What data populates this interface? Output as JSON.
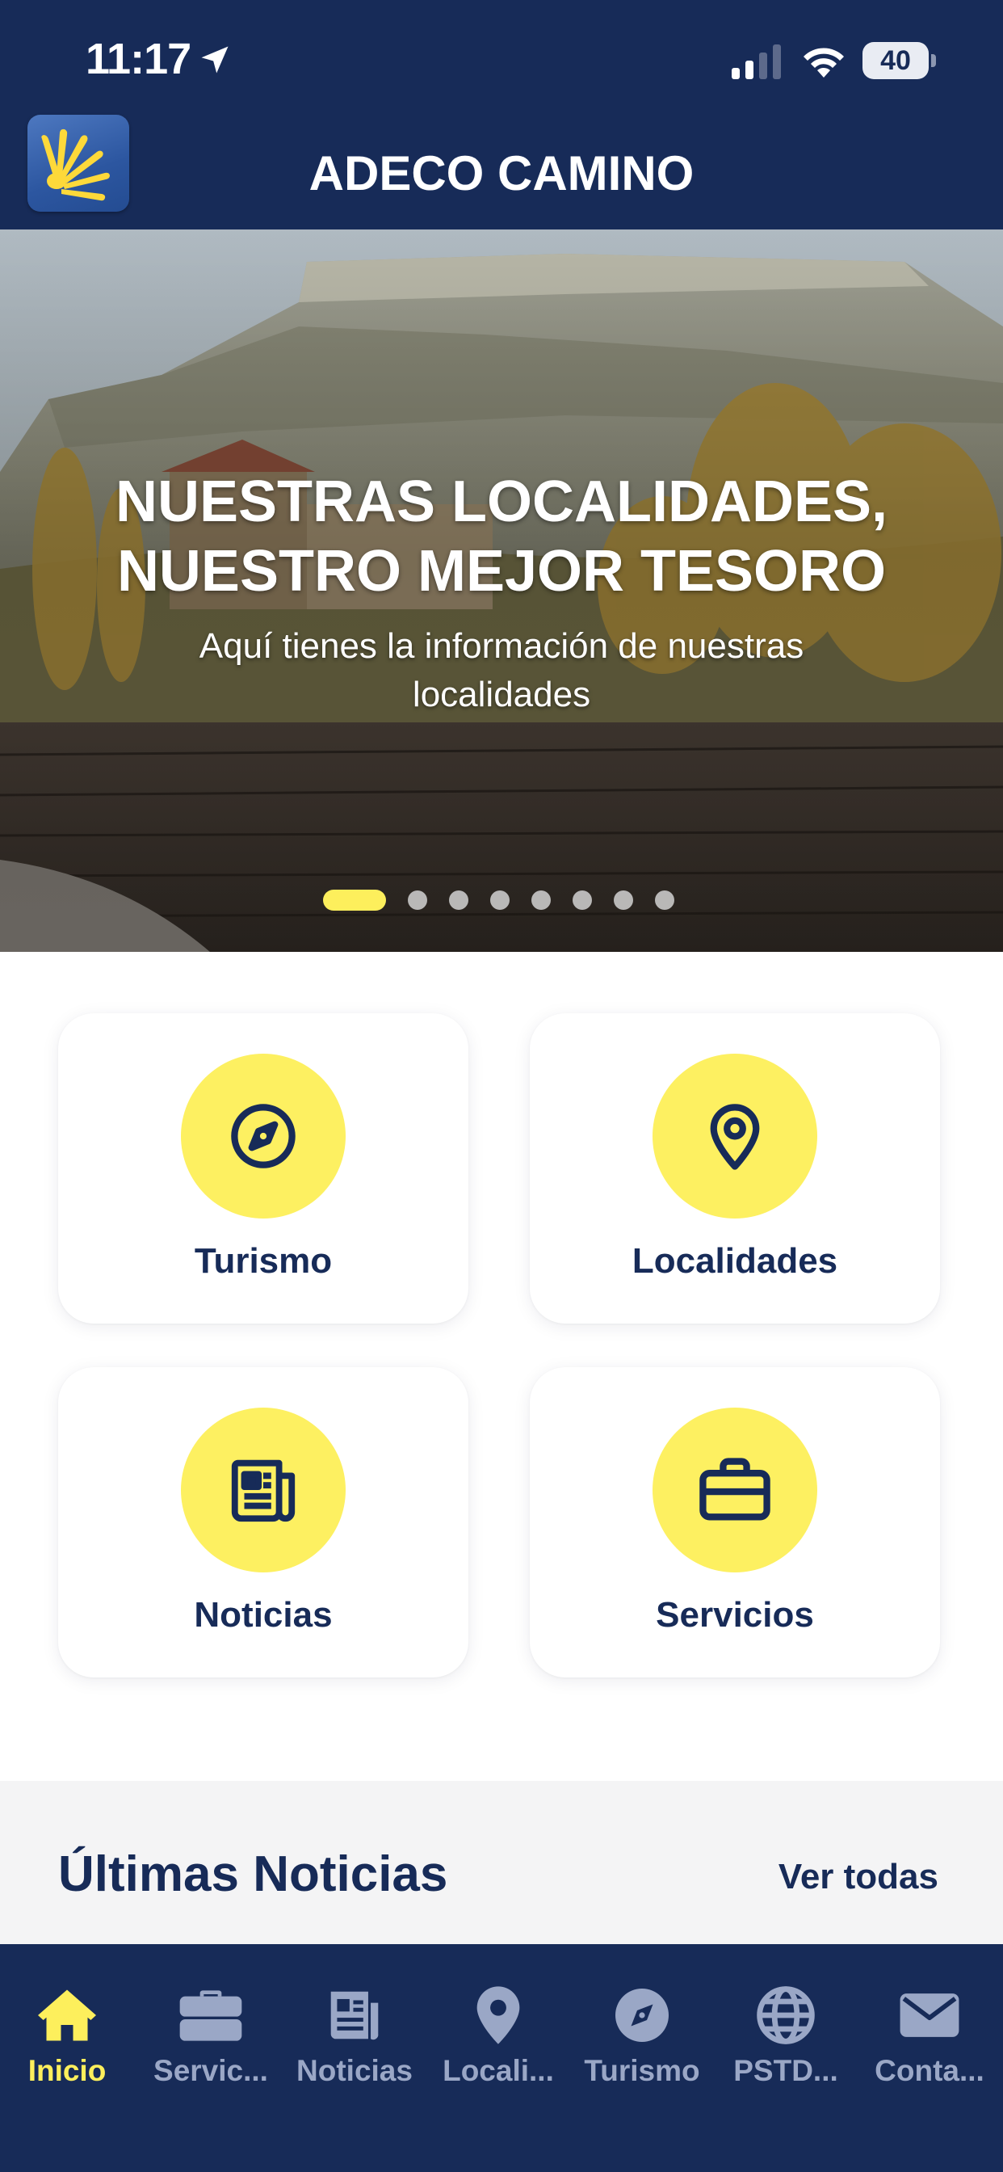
{
  "status_bar": {
    "time": "11:17",
    "battery": "40",
    "icons": [
      "location-arrow-icon",
      "cellular-signal-icon",
      "wifi-icon",
      "battery-icon"
    ]
  },
  "header": {
    "title": "ADECO CAMINO",
    "logo_icon": "scallop-shell-icon"
  },
  "hero": {
    "heading": "NUESTRAS LOCALIDADES, NUESTRO MEJOR TESORO",
    "subtitle": "Aquí tienes la información de nuestras localidades",
    "slide_count": 8,
    "active_slide": 1
  },
  "grid": {
    "items": [
      {
        "label": "Turismo",
        "icon": "compass-icon"
      },
      {
        "label": "Localidades",
        "icon": "map-pin-icon"
      },
      {
        "label": "Noticias",
        "icon": "newspaper-icon"
      },
      {
        "label": "Servicios",
        "icon": "briefcase-icon"
      }
    ]
  },
  "news": {
    "title": "Últimas Noticias",
    "see_all": "Ver todas"
  },
  "tabbar": {
    "items": [
      {
        "label": "Inicio",
        "icon": "home-icon",
        "active": true
      },
      {
        "label": "Servic...",
        "icon": "briefcase-icon",
        "active": false
      },
      {
        "label": "Noticias",
        "icon": "newspaper-icon",
        "active": false
      },
      {
        "label": "Locali...",
        "icon": "map-pin-icon",
        "active": false
      },
      {
        "label": "Turismo",
        "icon": "compass-icon",
        "active": false
      },
      {
        "label": "PSTD...",
        "icon": "globe-icon",
        "active": false
      },
      {
        "label": "Conta...",
        "icon": "mail-icon",
        "active": false
      }
    ]
  },
  "colors": {
    "navy": "#172b58",
    "yellow": "#fdef5c",
    "card_circle": "#fdf061",
    "tab_inactive": "#9aa7c6",
    "news_bg": "#f4f4f5"
  }
}
